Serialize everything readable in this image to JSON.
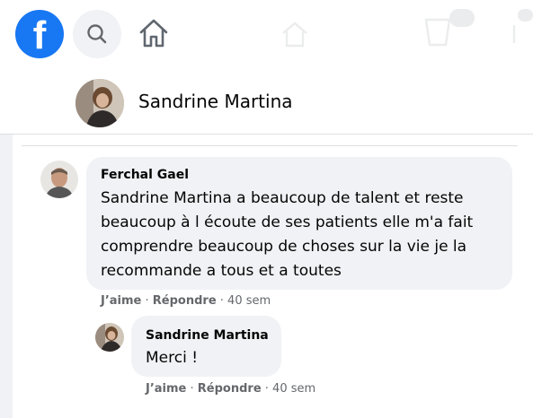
{
  "topbar": {
    "logo_glyph": "f",
    "icons": [
      "facebook-logo",
      "search-icon",
      "home-icon"
    ]
  },
  "profile": {
    "name": "Sandrine Martina"
  },
  "comments": [
    {
      "author": "Ferchal Gael",
      "text": "Sandrine Martina a beaucoup de talent et reste beaucoup à l écoute de ses patients elle m'a fait comprendre beaucoup de choses sur la vie je la recommande a tous et a toutes",
      "like_label": "J’aime",
      "sep1": " · ",
      "reply_label": "Répondre",
      "sep2": " · ",
      "time": "40 sem"
    },
    {
      "author": "Sandrine Martina",
      "text": "Merci !",
      "like_label": "J’aime",
      "sep1": " · ",
      "reply_label": "Répondre",
      "sep2": " · ",
      "time": "40 sem"
    }
  ],
  "colors": {
    "brand": "#1877f2",
    "bubble": "#f0f2f5",
    "secondary_text": "#65676b"
  }
}
